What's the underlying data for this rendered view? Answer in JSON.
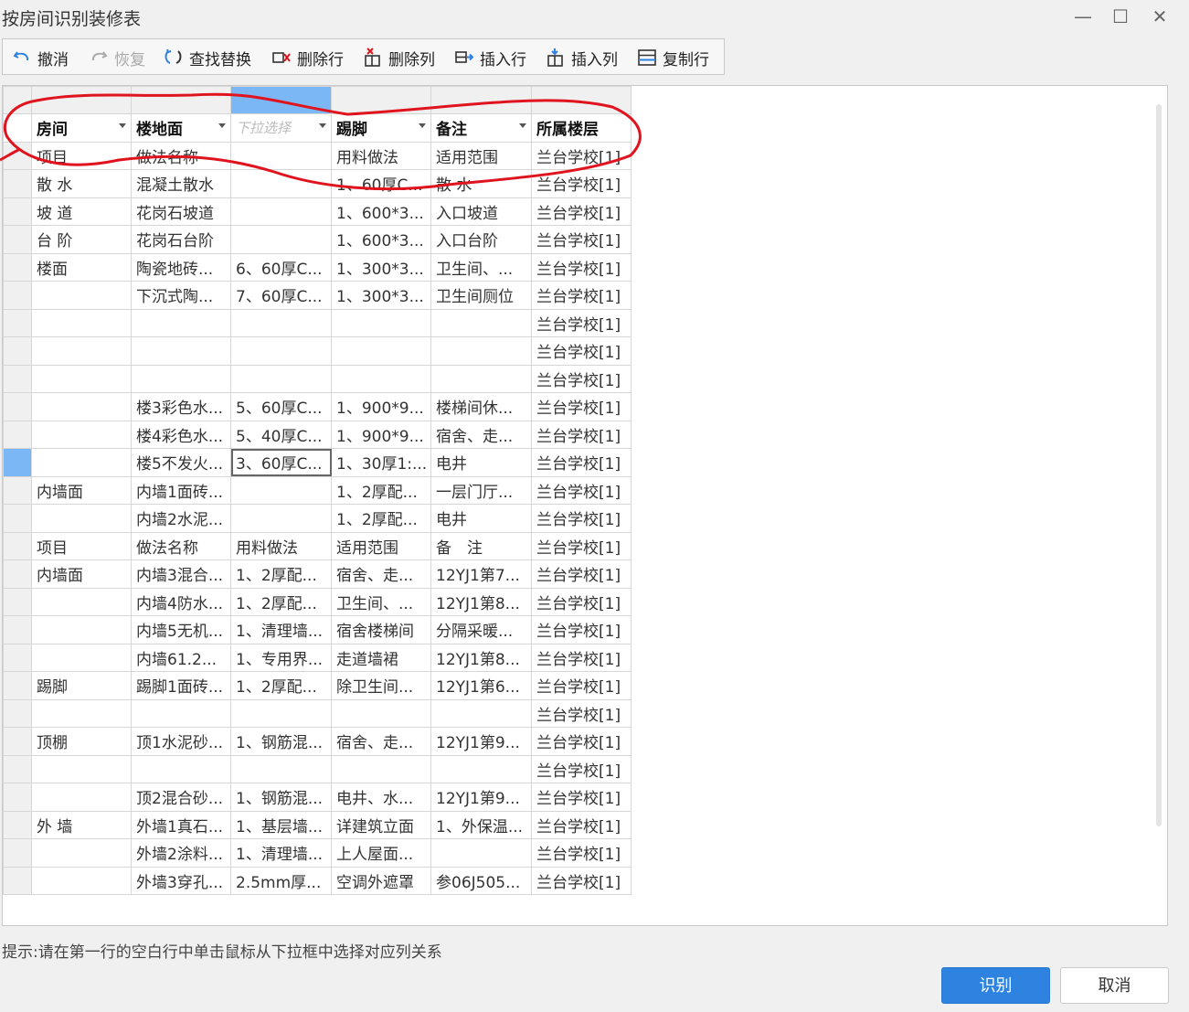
{
  "window": {
    "title": "按房间识别装修表",
    "minimize": "—",
    "maximize": "☐",
    "close": "✕"
  },
  "toolbar": {
    "undo": "撤消",
    "redo": "恢复",
    "find_replace": "查找替换",
    "delete_row": "删除行",
    "delete_col": "删除列",
    "insert_row": "插入行",
    "insert_col": "插入列",
    "copy_row": "复制行"
  },
  "table": {
    "mapping": [
      {
        "label": "房间",
        "placeholder": false
      },
      {
        "label": "楼地面",
        "placeholder": false
      },
      {
        "label": "下拉选择",
        "placeholder": true
      },
      {
        "label": "踢脚",
        "placeholder": false
      },
      {
        "label": "备注",
        "placeholder": false
      },
      {
        "label": "所属楼层",
        "placeholder": false,
        "nodropdown": true
      }
    ],
    "rows": [
      [
        "项目",
        "做法名称",
        "",
        "用料做法",
        "适用范围",
        "兰台学校[1]"
      ],
      [
        "散 水",
        "混凝土散水",
        "",
        "1、60厚C...",
        "散 水",
        "兰台学校[1]"
      ],
      [
        "坡 道",
        "花岗石坡道",
        "",
        "1、600*3...",
        "入口坡道",
        "兰台学校[1]"
      ],
      [
        "台 阶",
        "花岗石台阶",
        "",
        "1、600*3...",
        "入口台阶",
        "兰台学校[1]"
      ],
      [
        "楼面",
        "陶瓷地砖...",
        "6、60厚C...",
        "1、300*3...",
        "卫生间、...",
        "兰台学校[1]"
      ],
      [
        "",
        "下沉式陶...",
        "7、60厚C...",
        "1、300*3...",
        "卫生间厕位",
        "兰台学校[1]"
      ],
      [
        "",
        "",
        "",
        "",
        "",
        "兰台学校[1]"
      ],
      [
        "",
        "",
        "",
        "",
        "",
        "兰台学校[1]"
      ],
      [
        "",
        "",
        "",
        "",
        "",
        "兰台学校[1]"
      ],
      [
        "",
        "楼3彩色水...",
        "5、60厚C...",
        "1、900*9...",
        "楼梯间休...",
        "兰台学校[1]"
      ],
      [
        "",
        "楼4彩色水...",
        "5、40厚C...",
        "1、900*9...",
        "宿舍、走...",
        "兰台学校[1]"
      ],
      [
        "",
        "楼5不发火...",
        "3、60厚C...",
        "1、30厚1:...",
        "电井",
        "兰台学校[1]"
      ],
      [
        "内墙面",
        "内墙1面砖...",
        "",
        "1、2厚配...",
        "一层门厅...",
        "兰台学校[1]"
      ],
      [
        "",
        "内墙2水泥...",
        "",
        "1、2厚配...",
        "电井",
        "兰台学校[1]"
      ],
      [
        "项目",
        "做法名称",
        "用料做法",
        "适用范围",
        "备　注",
        "兰台学校[1]"
      ],
      [
        "内墙面",
        "内墙3混合...",
        "1、2厚配...",
        "宿舍、走...",
        "12YJ1第7...",
        "兰台学校[1]"
      ],
      [
        "",
        "内墙4防水...",
        "1、2厚配...",
        "卫生间、...",
        "12YJ1第8...",
        "兰台学校[1]"
      ],
      [
        "",
        "内墙5无机...",
        "1、清理墙...",
        "宿舍楼梯间",
        "分隔采暖...",
        "兰台学校[1]"
      ],
      [
        "",
        "内墙61.2...",
        "1、专用界...",
        "走道墙裙",
        "12YJ1第8...",
        "兰台学校[1]"
      ],
      [
        "踢脚",
        "踢脚1面砖...",
        "1、2厚配...",
        "除卫生间...",
        "12YJ1第6...",
        "兰台学校[1]"
      ],
      [
        "",
        "",
        "",
        "",
        "",
        "兰台学校[1]"
      ],
      [
        "顶棚",
        "顶1水泥砂...",
        "1、钢筋混...",
        "宿舍、走...",
        "12YJ1第9...",
        "兰台学校[1]"
      ],
      [
        "",
        "",
        "",
        "",
        "",
        "兰台学校[1]"
      ],
      [
        "",
        "顶2混合砂...",
        "1、钢筋混...",
        "电井、水...",
        "12YJ1第9...",
        "兰台学校[1]"
      ],
      [
        "外 墙",
        "外墙1真石...",
        "1、基层墙...",
        "详建筑立面",
        "1、外保温...",
        "兰台学校[1]"
      ],
      [
        "",
        "外墙2涂料...",
        "1、清理墙...",
        "上人屋面...",
        "",
        "兰台学校[1]"
      ],
      [
        "",
        "外墙3穿孔...",
        "2.5mm厚...",
        "空调外遮罩",
        "参06J505...",
        "兰台学校[1]"
      ]
    ]
  },
  "hint": "提示:请在第一行的空白行中单击鼠标从下拉框中选择对应列关系",
  "buttons": {
    "ok": "识别",
    "cancel": "取消"
  },
  "colors": {
    "primary": "#2e82e0",
    "annotation": "#e0141e",
    "selected": "#7cb7f5"
  }
}
